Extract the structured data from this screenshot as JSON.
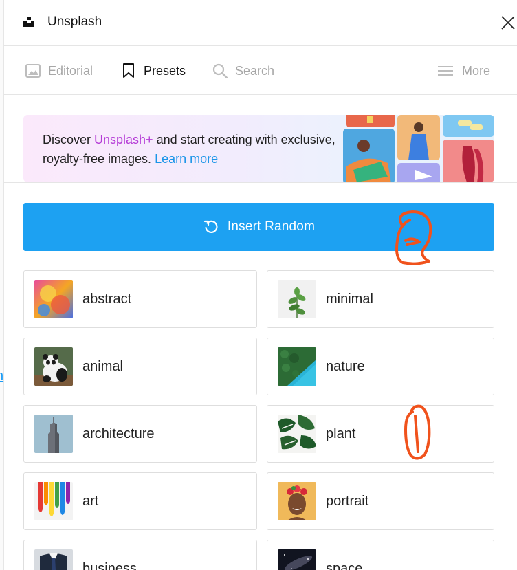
{
  "header": {
    "title": "Unsplash",
    "logo_icon": "unsplash-logo",
    "close_icon": "close-icon"
  },
  "tabs": [
    {
      "label": "Editorial",
      "icon": "image-icon",
      "active": false
    },
    {
      "label": "Presets",
      "icon": "bookmark-icon",
      "active": true
    },
    {
      "label": "Search",
      "icon": "search-icon",
      "active": false
    },
    {
      "label": "More",
      "icon": "menu-icon",
      "active": false
    }
  ],
  "banner": {
    "text_pre": "Discover ",
    "text_brand": "Unsplash+",
    "text_mid": " and start creating with exclusive, royalty-free images. ",
    "link_label": "Learn more"
  },
  "insert_random": {
    "label": "Insert Random",
    "icon": "refresh-icon"
  },
  "presets": [
    {
      "label": "abstract",
      "thumb": "abstract"
    },
    {
      "label": "minimal",
      "thumb": "minimal"
    },
    {
      "label": "animal",
      "thumb": "animal"
    },
    {
      "label": "nature",
      "thumb": "nature"
    },
    {
      "label": "architecture",
      "thumb": "architecture"
    },
    {
      "label": "plant",
      "thumb": "plant"
    },
    {
      "label": "art",
      "thumb": "art"
    },
    {
      "label": "portrait",
      "thumb": "portrait"
    },
    {
      "label": "business",
      "thumb": "business"
    },
    {
      "label": "space",
      "thumb": "space"
    }
  ],
  "annotations": {
    "mark_1": "1",
    "mark_2": "2",
    "color": "#f0521c"
  },
  "colors": {
    "accent": "#1da1f2",
    "brand_plus": "#b43bd6",
    "link": "#1a95e8"
  }
}
